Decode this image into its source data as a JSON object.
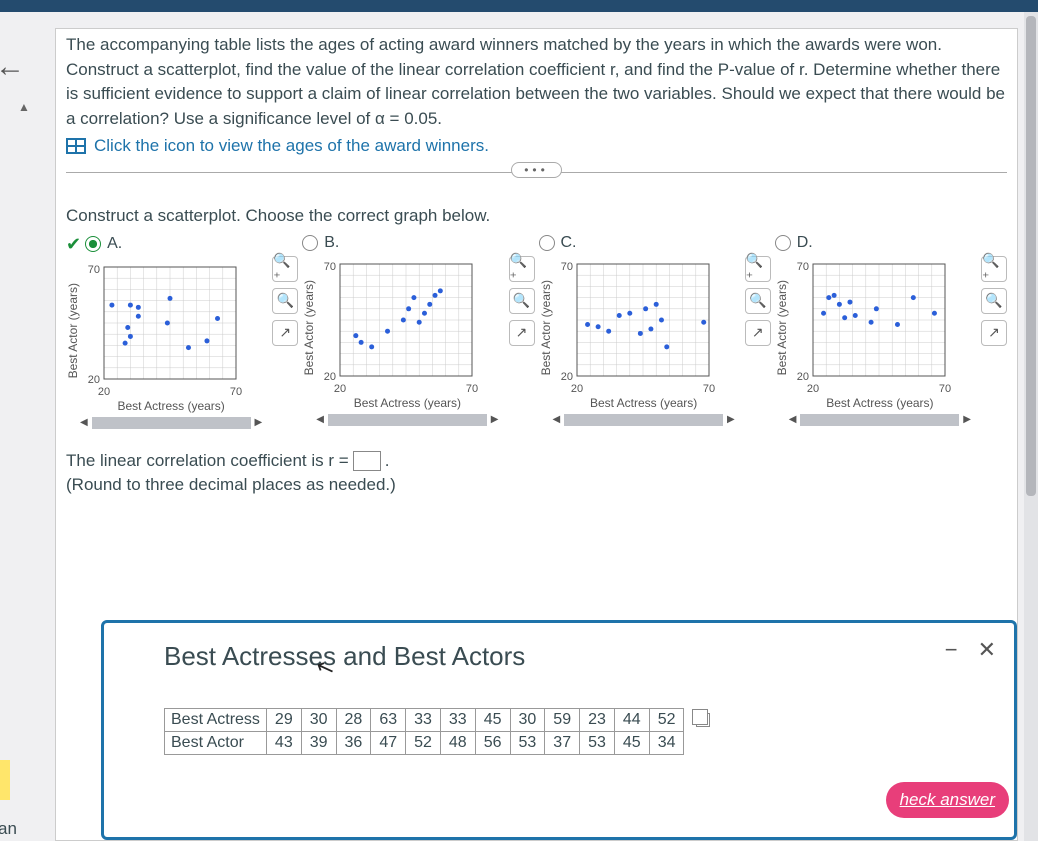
{
  "question_text": "The accompanying table lists the ages of acting award winners matched by the years in which the awards were won. Construct a scatterplot, find the value of the linear correlation coefficient r, and find the P-value of r. Determine whether there is sufficient evidence to support a claim of linear correlation between the two variables. Should we expect that there would be a correlation? Use a significance level of α = 0.05.",
  "view_link": "Click the icon to view the ages of the award winners.",
  "scatter_prompt": "Construct a scatterplot. Choose the correct graph below.",
  "options": [
    "A.",
    "B.",
    "C.",
    "D."
  ],
  "axis": {
    "x": "Best Actress (years)",
    "y": "Best Actor (years)",
    "xmin": "20",
    "xmax": "70",
    "ymin": "20",
    "ymax": "70"
  },
  "r_sentence_pre": "The linear correlation coefficient is r =",
  "r_sentence_post": ".",
  "round_note": "(Round to three decimal places as needed.)",
  "modal_title": "Best Actresses and Best Actors",
  "table": {
    "row1_label": "Best Actress",
    "row2_label": "Best Actor",
    "r1": [
      "29",
      "30",
      "28",
      "63",
      "33",
      "33",
      "45",
      "30",
      "59",
      "23",
      "44",
      "52"
    ],
    "r2": [
      "43",
      "39",
      "36",
      "47",
      "52",
      "48",
      "56",
      "53",
      "37",
      "53",
      "45",
      "34"
    ]
  },
  "check_btn": "heck answer",
  "frag": "an",
  "chart_data": [
    {
      "type": "scatter",
      "title": "A",
      "xlabel": "Best Actress (years)",
      "ylabel": "Best Actor (years)",
      "xlim": [
        20,
        70
      ],
      "ylim": [
        20,
        70
      ],
      "series": [
        {
          "name": "pts",
          "x": [
            23,
            28,
            29,
            30,
            30,
            33,
            33,
            44,
            45,
            52,
            59,
            63
          ],
          "y": [
            53,
            36,
            43,
            39,
            53,
            48,
            52,
            45,
            56,
            34,
            37,
            47
          ]
        }
      ]
    },
    {
      "type": "scatter",
      "title": "B",
      "xlabel": "Best Actress (years)",
      "ylabel": "Best Actor (years)",
      "xlim": [
        20,
        70
      ],
      "ylim": [
        20,
        70
      ],
      "series": [
        {
          "name": "pts",
          "x": [
            26,
            28,
            32,
            38,
            44,
            46,
            48,
            50,
            52,
            54,
            56,
            58
          ],
          "y": [
            38,
            35,
            33,
            40,
            45,
            50,
            55,
            44,
            48,
            52,
            56,
            58
          ]
        }
      ]
    },
    {
      "type": "scatter",
      "title": "C",
      "xlabel": "Best Actress (years)",
      "ylabel": "Best Actor (years)",
      "xlim": [
        20,
        70
      ],
      "ylim": [
        20,
        70
      ],
      "series": [
        {
          "name": "pts",
          "x": [
            24,
            28,
            32,
            36,
            40,
            44,
            46,
            48,
            50,
            52,
            54,
            68
          ],
          "y": [
            43,
            42,
            40,
            47,
            48,
            39,
            50,
            41,
            52,
            45,
            33,
            44
          ]
        }
      ]
    },
    {
      "type": "scatter",
      "title": "D",
      "xlabel": "Best Actress (years)",
      "ylabel": "Best Actor (years)",
      "xlim": [
        20,
        70
      ],
      "ylim": [
        20,
        70
      ],
      "series": [
        {
          "name": "pts",
          "x": [
            24,
            26,
            28,
            30,
            32,
            34,
            36,
            42,
            44,
            52,
            58,
            66
          ],
          "y": [
            48,
            55,
            56,
            52,
            46,
            53,
            47,
            44,
            50,
            43,
            55,
            48
          ]
        }
      ]
    }
  ]
}
